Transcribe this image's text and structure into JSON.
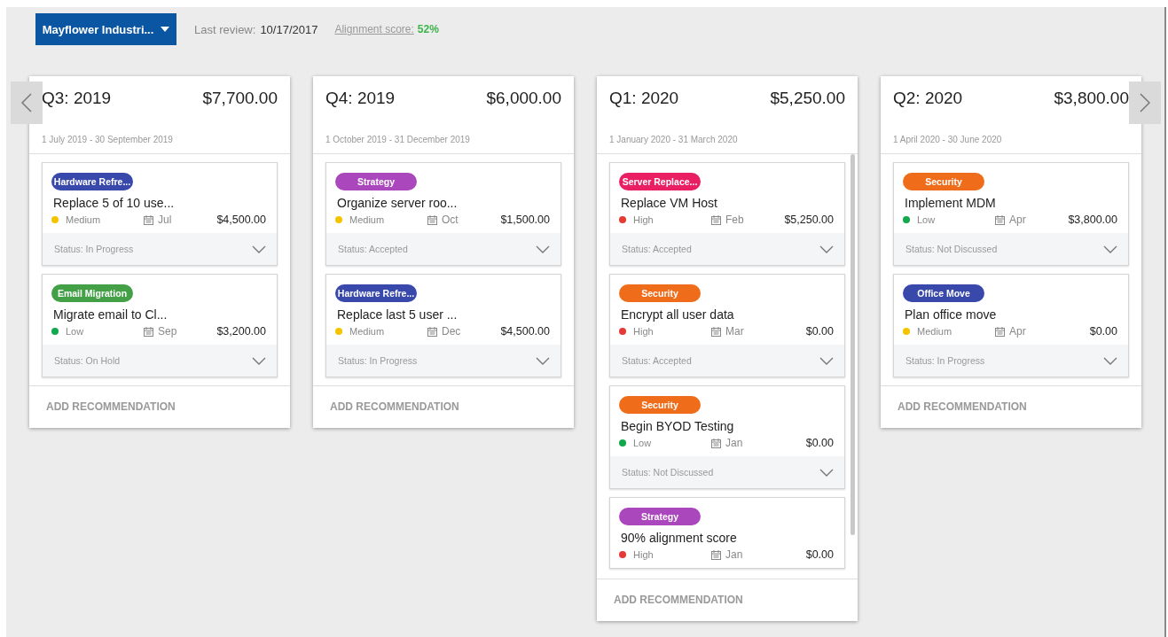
{
  "header": {
    "client_button": "Mayflower Industri...",
    "last_review_label": "Last review:",
    "last_review_date": "10/17/2017",
    "alignment_label": "Alignment score:",
    "alignment_value": "52%"
  },
  "nav": {
    "prev": true,
    "next": true
  },
  "columns": [
    {
      "title": "Q3: 2019",
      "total": "$7,700.00",
      "dates": "1 July 2019 - 30 September 2019",
      "scrollbar": false,
      "add_label": "ADD RECOMMENDATION",
      "cards": [
        {
          "tag": {
            "label": "Hardware Refre...",
            "color": "#3949ab"
          },
          "title": "Replace 5 of 10 use...",
          "priority": {
            "label": "Medium",
            "color": "#f5c400"
          },
          "month": "Jul",
          "amount": "$4,500.00",
          "status": "Status: In Progress"
        },
        {
          "tag": {
            "label": "Email Migration",
            "color": "#43a047"
          },
          "title": "Migrate email to Cl...",
          "priority": {
            "label": "Low",
            "color": "#10a84a"
          },
          "month": "Sep",
          "amount": "$3,200.00",
          "status": "Status: On Hold"
        }
      ]
    },
    {
      "title": "Q4: 2019",
      "total": "$6,000.00",
      "dates": "1 October 2019 - 31 December 2019",
      "scrollbar": false,
      "add_label": "ADD RECOMMENDATION",
      "cards": [
        {
          "tag": {
            "label": "Strategy",
            "color": "#ab47bc"
          },
          "title": "Organize server roo...",
          "priority": {
            "label": "Medium",
            "color": "#f5c400"
          },
          "month": "Oct",
          "amount": "$1,500.00",
          "status": "Status: Accepted"
        },
        {
          "tag": {
            "label": "Hardware Refre...",
            "color": "#3949ab"
          },
          "title": "Replace last 5 user ...",
          "priority": {
            "label": "Medium",
            "color": "#f5c400"
          },
          "month": "Dec",
          "amount": "$4,500.00",
          "status": "Status: In Progress"
        }
      ]
    },
    {
      "title": "Q1: 2020",
      "total": "$5,250.00",
      "dates": "1 January 2020 - 31 March 2020",
      "scrollbar": true,
      "add_label": "ADD RECOMMENDATION",
      "cards": [
        {
          "tag": {
            "label": "Server Replace...",
            "color": "#e91e63"
          },
          "title": "Replace VM Host",
          "priority": {
            "label": "High",
            "color": "#e53935"
          },
          "month": "Feb",
          "amount": "$5,250.00",
          "status": "Status: Accepted"
        },
        {
          "tag": {
            "label": "Security",
            "color": "#ef6c1a"
          },
          "title": "Encrypt all user data",
          "priority": {
            "label": "High",
            "color": "#e53935"
          },
          "month": "Mar",
          "amount": "$0.00",
          "status": "Status: Accepted"
        },
        {
          "tag": {
            "label": "Security",
            "color": "#ef6c1a"
          },
          "title": "Begin BYOD Testing",
          "priority": {
            "label": "Low",
            "color": "#10a84a"
          },
          "month": "Jan",
          "amount": "$0.00",
          "status": "Status: Not Discussed"
        },
        {
          "tag": {
            "label": "Strategy",
            "color": "#ab47bc"
          },
          "title": "90% alignment score",
          "priority": {
            "label": "High",
            "color": "#e53935"
          },
          "month": "Jan",
          "amount": "$0.00"
        }
      ]
    },
    {
      "title": "Q2: 2020",
      "total": "$3,800.00",
      "dates": "1 April 2020 - 30 June 2020",
      "scrollbar": false,
      "add_label": "ADD RECOMMENDATION",
      "cards": [
        {
          "tag": {
            "label": "Security",
            "color": "#ef6c1a"
          },
          "title": "Implement MDM",
          "priority": {
            "label": "Low",
            "color": "#10a84a"
          },
          "month": "Apr",
          "amount": "$3,800.00",
          "status": "Status: Not Discussed"
        },
        {
          "tag": {
            "label": "Office Move",
            "color": "#3949ab"
          },
          "title": "Plan office move",
          "priority": {
            "label": "Medium",
            "color": "#f5c400"
          },
          "month": "Apr",
          "amount": "$0.00",
          "status": "Status: In Progress"
        }
      ]
    }
  ]
}
